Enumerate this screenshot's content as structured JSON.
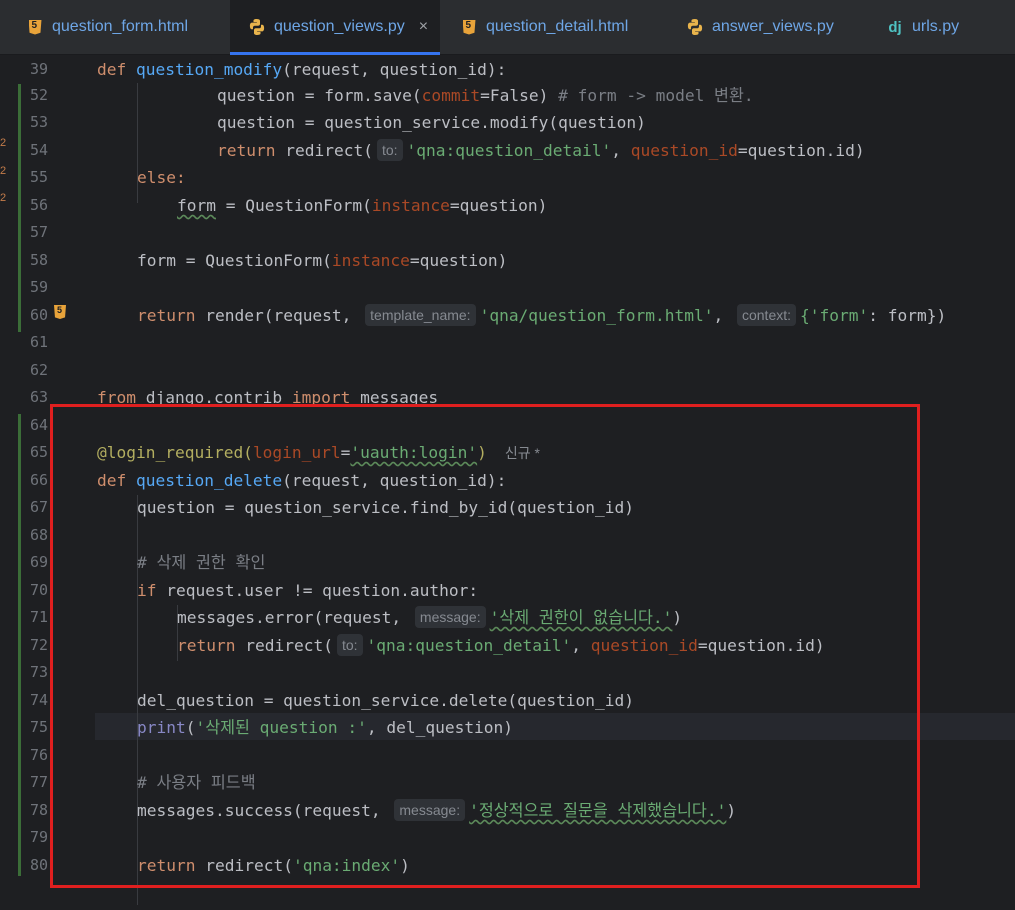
{
  "tabs": [
    {
      "label": "question_form.html",
      "icon": "html5-icon"
    },
    {
      "label": "question_views.py",
      "icon": "python-icon",
      "active": true,
      "close": "×"
    },
    {
      "label": "question_detail.html",
      "icon": "html5-icon"
    },
    {
      "label": "answer_views.py",
      "icon": "python-icon"
    },
    {
      "label": "urls.py",
      "icon": "django-icon",
      "icon_text": "dj"
    }
  ],
  "line_numbers": [
    "39",
    "52",
    "53",
    "54",
    "55",
    "56",
    "57",
    "58",
    "59",
    "60",
    "61",
    "62",
    "63",
    "64",
    "65",
    "66",
    "67",
    "68",
    "69",
    "70",
    "71",
    "72",
    "73",
    "74",
    "75",
    "76",
    "77",
    "78",
    "79",
    "80"
  ],
  "gutter_marks": [
    "2",
    "2",
    "2"
  ],
  "hints": {
    "to": "to:",
    "template_name": "template_name:",
    "context": "context:",
    "message": "message:"
  },
  "code": {
    "l39": {
      "kw": "def ",
      "fn": "question_modify",
      "rest": "(request, question_id):"
    },
    "l52": {
      "a": "question = form.save(",
      "p": "commit",
      "b": "=False) ",
      "c": "# form -> model 변환."
    },
    "l53": {
      "a": "question = question_service.modify(question)"
    },
    "l54": {
      "kw": "return ",
      "a": "redirect(",
      "s": "'qna:question_detail'",
      "b": ", ",
      "p": "question_id",
      "c": "=question.id)"
    },
    "l55": {
      "kw": "else:"
    },
    "l56": {
      "a": "form",
      "b": " = QuestionForm(",
      "p": "instance",
      "c": "=question)"
    },
    "l58": {
      "a": "form = QuestionForm(",
      "p": "instance",
      "c": "=question)"
    },
    "l60": {
      "kw": "return ",
      "a": "render(request, ",
      "s1": "'qna/question_form.html'",
      "b": ", ",
      "s2": "{'form'",
      "c": ": form})"
    },
    "l63": {
      "kw1": "from ",
      "a": "django.contrib ",
      "kw2": "import ",
      "b": "messages"
    },
    "l65": {
      "deco": "@login_required(",
      "p": "login_url",
      "eq": "=",
      "s": "'uauth:login'",
      "end": ")",
      "badge": "신규 *"
    },
    "l66": {
      "kw": "def ",
      "fn": "question_delete",
      "rest": "(request, question_id):"
    },
    "l67": {
      "a": "question = question_service.find_by_id(question_id)"
    },
    "l69": {
      "c": "# 삭제 권한 확인"
    },
    "l70": {
      "kw": "if ",
      "a": "request.user != question.author:"
    },
    "l71": {
      "a": "messages.error(request, ",
      "s": "'삭제 권한이 없습니다.'",
      "b": ")"
    },
    "l72": {
      "kw": "return ",
      "a": "redirect(",
      "s": "'qna:question_detail'",
      "b": ", ",
      "p": "question_id",
      "c": "=question.id)"
    },
    "l74": {
      "a": "del_question = question_service.delete(question_id)"
    },
    "l75": {
      "bi": "print",
      "a": "(",
      "s": "'삭제된 question :'",
      "b": ", del_question)"
    },
    "l77": {
      "c": "# 사용자 피드백"
    },
    "l78": {
      "a": "messages.success(request, ",
      "s": "'정상적으로 질문을 삭제했습니다.'",
      "b": ")"
    },
    "l80": {
      "kw": "return ",
      "a": "redirect(",
      "s": "'qna:index'",
      "b": ")"
    }
  },
  "colors": {
    "highlight_box": "#e01f1f",
    "accent": "#3574f0"
  }
}
